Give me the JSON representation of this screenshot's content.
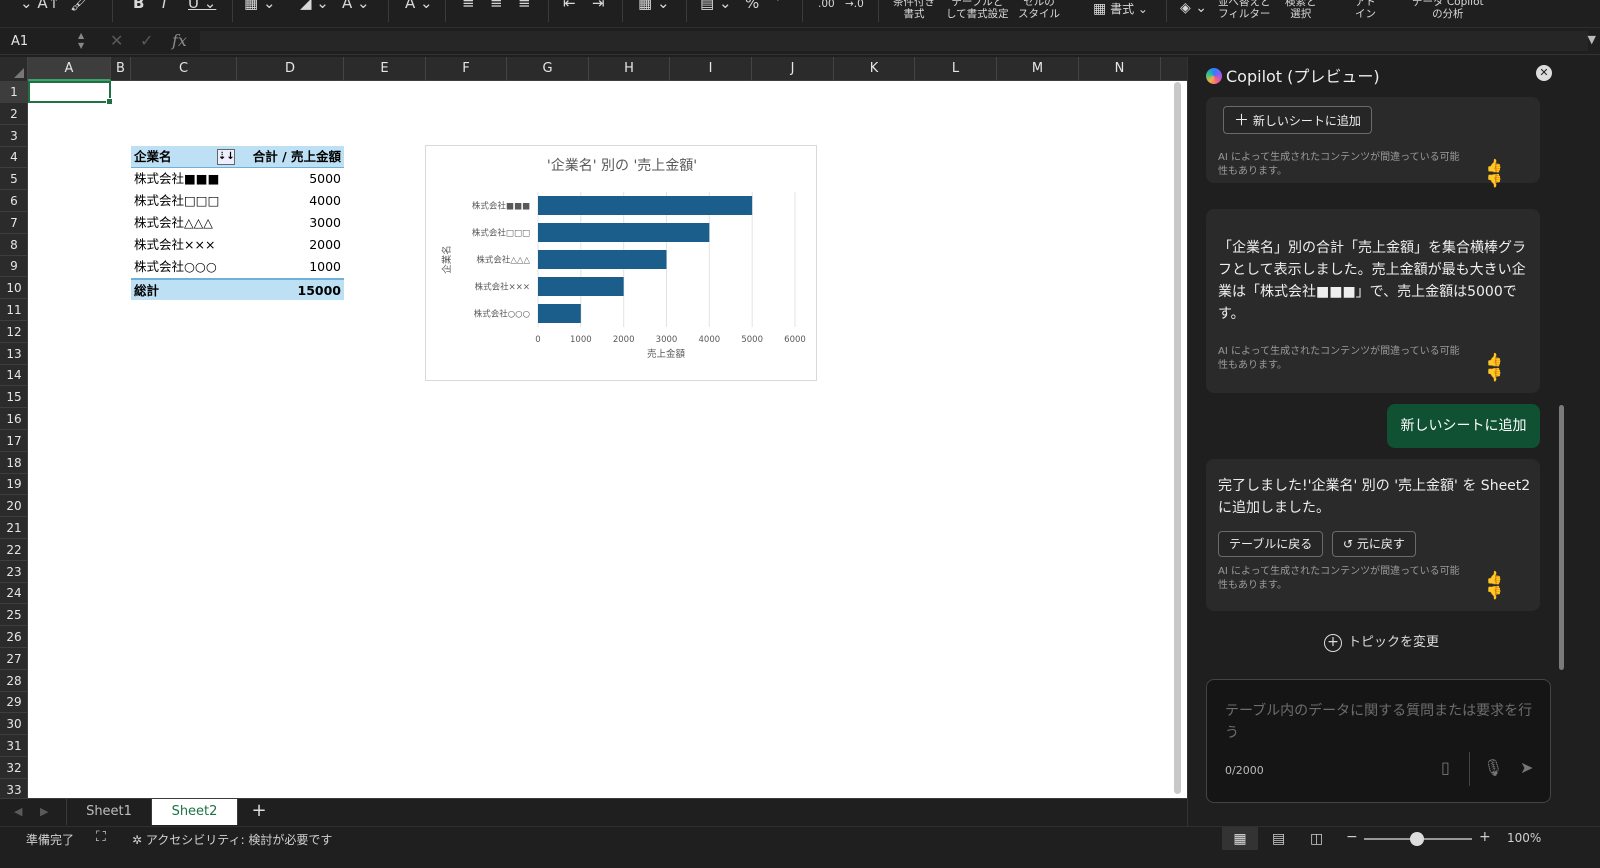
{
  "ribbon": {
    "icons": [
      "⌄ A↑",
      "🖌",
      "B",
      "I",
      "U ⌄",
      "▦ ⌄",
      "◢ ⌄",
      "A ⌄",
      "A ⌄",
      "≡",
      "≡",
      "≡",
      "⇤",
      "⇥",
      "▦ ⌄",
      "▤ ⌄",
      "%",
      "’",
      ".00",
      "→.0"
    ],
    "groups": [
      {
        "label": "条件付き\n書式"
      },
      {
        "label": "テーブルと\nして書式設定"
      },
      {
        "label": "セルの\nスタイル"
      },
      {
        "label": "書式 ⌄"
      },
      {
        "label": "並べ替えと\nフィルター"
      },
      {
        "label": "検索と\n選択"
      },
      {
        "label": "アド\nイン"
      },
      {
        "label": "データ Copilot\nの分析"
      }
    ]
  },
  "formula_bar": {
    "name_box": "A1",
    "cancel_icon": "✕",
    "enter_icon": "✓",
    "fx_label": "fx",
    "value": ""
  },
  "grid": {
    "columns": [
      "A",
      "B",
      "C",
      "D",
      "E",
      "F",
      "G",
      "H",
      "I",
      "J",
      "K",
      "L",
      "M",
      "N"
    ],
    "rows": [
      "1",
      "2",
      "3",
      "4",
      "5",
      "6",
      "7",
      "8",
      "9",
      "10",
      "11",
      "12",
      "13",
      "14",
      "15",
      "16",
      "17",
      "18",
      "19",
      "20",
      "21",
      "22",
      "23",
      "24",
      "25",
      "26",
      "27",
      "28",
      "29",
      "30",
      "31",
      "32",
      "33"
    ],
    "selected_cell": "A1"
  },
  "pivot": {
    "header_name": "企業名",
    "header_value": "合計 / 売上金額",
    "filter_icon": "⇣↓",
    "rows": [
      {
        "name": "株式会社■■■",
        "value": "5000"
      },
      {
        "name": "株式会社□□□",
        "value": "4000"
      },
      {
        "name": "株式会社△△△",
        "value": "3000"
      },
      {
        "name": "株式会社×××",
        "value": "2000"
      },
      {
        "name": "株式会社○○○",
        "value": "1000"
      }
    ],
    "total_label": "総計",
    "total_value": "15000"
  },
  "chart_data": {
    "type": "bar",
    "orientation": "horizontal",
    "title": "'企業名' 別の '売上金額'",
    "xlabel": "売上金額",
    "ylabel": "企業名",
    "categories": [
      "株式会社■■■",
      "株式会社□□□",
      "株式会社△△△",
      "株式会社×××",
      "株式会社○○○"
    ],
    "values": [
      5000,
      4000,
      3000,
      2000,
      1000
    ],
    "xlim": [
      0,
      6000
    ],
    "x_ticks": [
      0,
      1000,
      2000,
      3000,
      4000,
      5000,
      6000
    ],
    "grid": true,
    "bar_color": "#1b5e8c"
  },
  "sheets": {
    "tabs": [
      "Sheet1",
      "Sheet2"
    ],
    "active": "Sheet2",
    "add_icon": "+",
    "prev_icon": "◀",
    "next_icon": "▶"
  },
  "status": {
    "ready": "準備完了",
    "accessibility": "アクセシビリティ: 検討が必要です",
    "zoom": "100%",
    "zoom_minus": "−",
    "zoom_plus": "+"
  },
  "copilot": {
    "title": "Copilot (プレビュー)",
    "close_icon": "✕",
    "add_sheet_button": "新しいシートに追加",
    "disclaimer": "AI によって生成されたコンテンツが間違っている可能性もあります。",
    "message1": "「企業名」別の合計「売上金額」を集合横棒グラフとして表示しました。売上金額が最も大きい企業は「株式会社■■■」で、売上金額は5000です。",
    "user_message": "新しいシートに追加",
    "message2": "完了しました!'企業名' 別の '売上金額' を Sheet2 に追加しました。",
    "back_to_table_button": "テーブルに戻る",
    "undo_button": "元に戻す",
    "change_topic": "トピックを変更",
    "input_placeholder": "テーブル内のデータに関する質問または要求を行う",
    "counter": "0/2000",
    "thumbs_up_icon": "👍",
    "thumbs_down_icon": "👎"
  },
  "colors": {
    "accent": "#1e7145",
    "pivot_header": "#bde0f4",
    "user_bubble": "#0f5132"
  }
}
